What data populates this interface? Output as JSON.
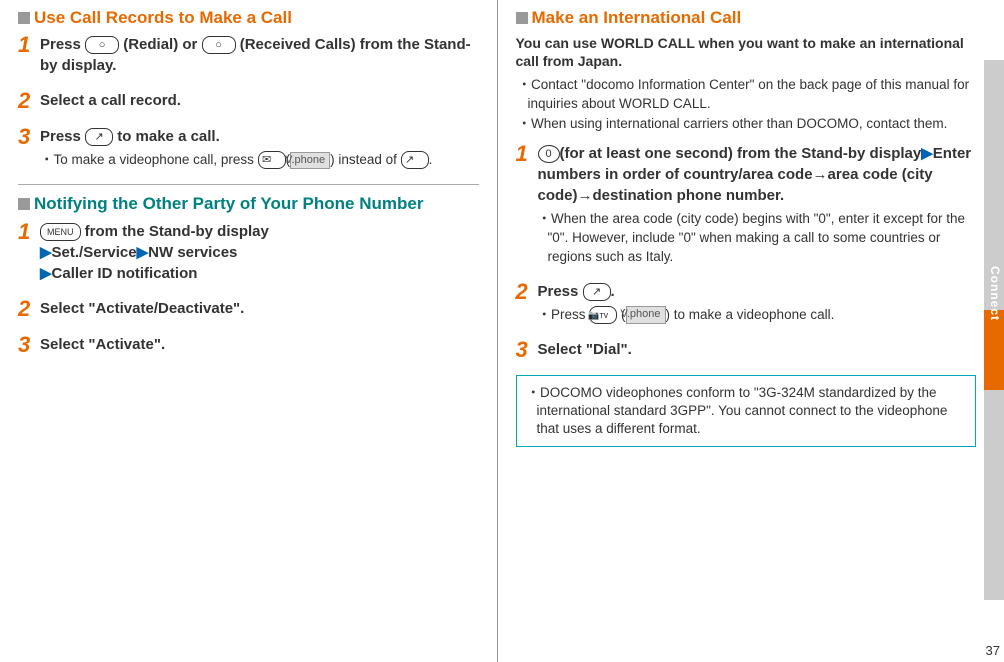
{
  "left": {
    "section1": {
      "title": "Use Call Records to Make a Call",
      "steps": [
        {
          "pre": "Press ",
          "key1": "○",
          "mid": " (Redial) or ",
          "key2": "○",
          "post": " (Received Calls) from the Stand-by display."
        },
        {
          "text": "Select a call record."
        },
        {
          "pre": "Press ",
          "key": "↗",
          "post": " to make a call.",
          "sub_pre": "・To make a videophone call, press ",
          "sub_key": "✉",
          "sub_btn": "V.phone",
          "sub_mid": "(",
          "sub_mid2": ") instead of ",
          "sub_key2": "↗",
          "sub_end": "."
        }
      ]
    },
    "section2": {
      "title": "Notifying the Other Party of Your Phone Number",
      "steps": [
        {
          "key": "MENU",
          "mid": " from the Stand-by display",
          "l2a": "Set./Service",
          "l2b": "NW services",
          "l3": "Caller ID notification"
        },
        {
          "text": "Select \"Activate/Deactivate\"."
        },
        {
          "text": "Select \"Activate\"."
        }
      ]
    }
  },
  "right": {
    "title": "Make an International Call",
    "intro": "You can use WORLD CALL when you want to make an international call from Japan.",
    "bullets": [
      "・Contact \"docomo Information Center\" on the back page of this manual for inquiries about WORLD CALL.",
      "・When using international carriers other than DOCOMO, contact them."
    ],
    "steps": [
      {
        "key": "0",
        "mid": "(for at least one second) from the Stand-by display",
        "l2": "Enter numbers in order of country/area code→area code (city code)→destination phone number.",
        "sub": "・When the area code (city code) begins with \"0\", enter it except for the \"0\". However, include \"0\" when making a call to some countries or regions such as Italy."
      },
      {
        "pre": "Press ",
        "key": "↗",
        "post": ".",
        "sub_pre": "・Press ",
        "sub_key": "📷ᴛᴠ",
        "sub_mid": " (",
        "sub_btn": "V.phone",
        "sub_post": ") to make a videophone call."
      },
      {
        "text": "Select \"Dial\"."
      }
    ],
    "note": "・DOCOMO videophones conform to \"3G-324M standardized by the international standard 3GPP\". You cannot connect to the videophone that uses a different format."
  },
  "sideTab": "Connect",
  "pageNum": "37"
}
